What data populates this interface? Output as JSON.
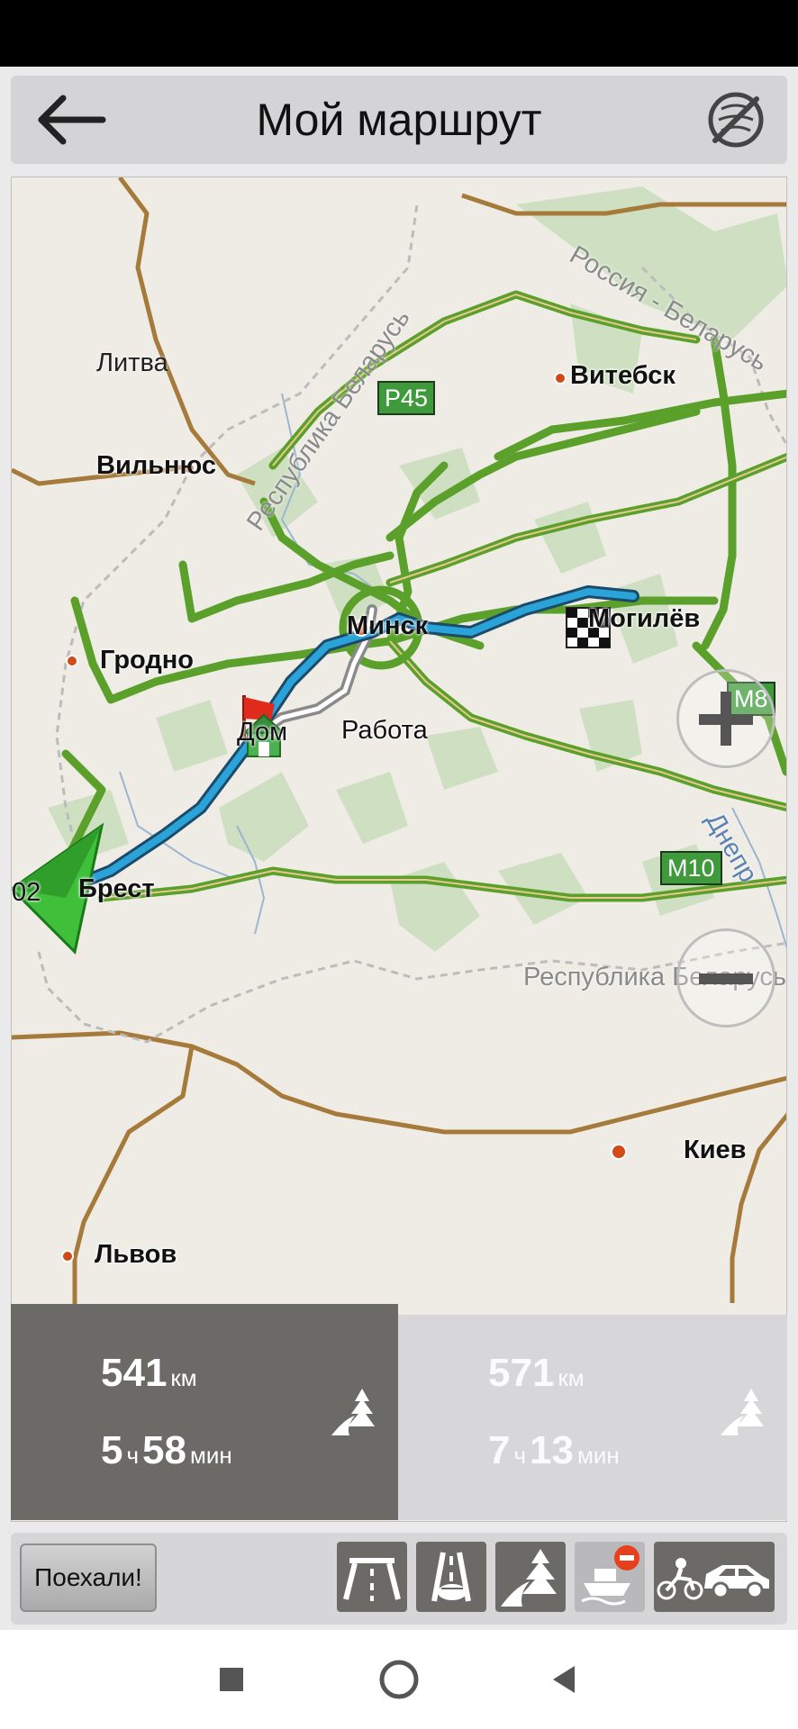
{
  "header": {
    "title": "Мой маршрут"
  },
  "map": {
    "countries": {
      "lithuania": "Литва",
      "belarus_nw": "Республика Беларусь",
      "russia_belarus": "Россия - Беларусь",
      "belarus_s": "Республика Беларусь"
    },
    "cities": {
      "vilnius": "Вильнюс",
      "vitebsk": "Витебск",
      "grodno": "Гродно",
      "minsk": "Минск",
      "mogilev": "Могилёв",
      "brest": "Брест",
      "kiev": "Киев",
      "lviv": "Львов"
    },
    "places": {
      "home": "Дом",
      "work": "Работа"
    },
    "river": "Днепр",
    "road_signs": {
      "p45": "P45",
      "m8": "M8",
      "m10": "M10"
    },
    "position_label": "02"
  },
  "routes": [
    {
      "distance": "541",
      "distance_unit": "км",
      "hours": "5",
      "hours_unit": "ч",
      "minutes": "58",
      "minutes_unit": "мин",
      "selected": true
    },
    {
      "distance": "571",
      "distance_unit": "км",
      "hours": "7",
      "hours_unit": "ч",
      "minutes": "13",
      "minutes_unit": "мин",
      "selected": false
    }
  ],
  "toolbar": {
    "go_label": "Поехали!",
    "options": [
      "highway-icon",
      "toll-road-icon",
      "unpaved-road-icon",
      "ferry-icon",
      "vehicle-type-icon"
    ]
  },
  "colors": {
    "route_main": "#2aa3d8",
    "route_alt": "#8a8a8a",
    "road_major": "#5aa02a",
    "road_border": "#a57a3a",
    "panel_active": "#6b6a67",
    "panel_alt": "#d7d7d9"
  }
}
